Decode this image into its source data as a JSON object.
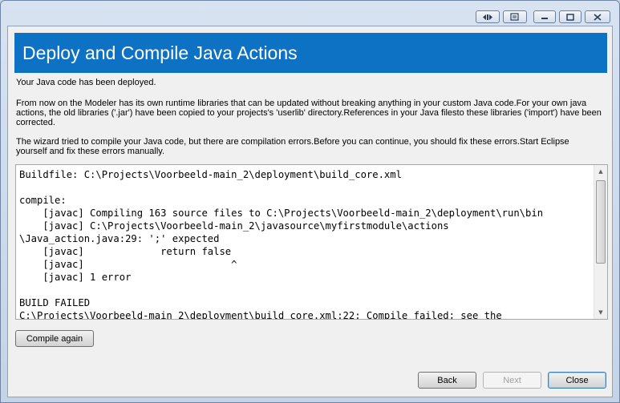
{
  "window": {
    "controls": {
      "left_icon": "left-right-arrows-icon",
      "right_icon": "form-icon",
      "minimize": "minimize-icon",
      "maximize": "maximize-icon",
      "close": "close-icon"
    }
  },
  "banner": {
    "title": "Deploy and Compile Java Actions",
    "color": "#0e72c4"
  },
  "messages": {
    "deployed": "Your Java code has been deployed.",
    "libraries": "From now on the Modeler has its own runtime libraries that can be updated without breaking anything in your custom Java code.For your own java actions, the old libraries ('.jar') have been copied to your projects's 'userlib' directory.References in your Java filesto these libraries ('import') have been corrected.",
    "errors": "The wizard tried to compile your Java code, but there are compilation errors.Before you can continue, you should fix these errors.Start Eclipse yourself and fix these errors manually."
  },
  "console": {
    "lines": [
      "Buildfile: C:\\Projects\\Voorbeeld-main_2\\deployment\\build_core.xml",
      "",
      "compile:",
      "    [javac] Compiling 163 source files to C:\\Projects\\Voorbeeld-main_2\\deployment\\run\\bin",
      "    [javac] C:\\Projects\\Voorbeeld-main_2\\javasource\\myfirstmodule\\actions",
      "\\Java_action.java:29: ';' expected",
      "    [javac]             return false",
      "    [javac]                         ^",
      "    [javac] 1 error",
      "",
      "BUILD FAILED",
      "C:\\Projects\\Voorbeeld-main_2\\deployment\\build_core.xml:22: Compile failed; see the"
    ]
  },
  "buttons": {
    "compile_again": "Compile again",
    "back": "Back",
    "next": "Next",
    "close": "Close"
  }
}
